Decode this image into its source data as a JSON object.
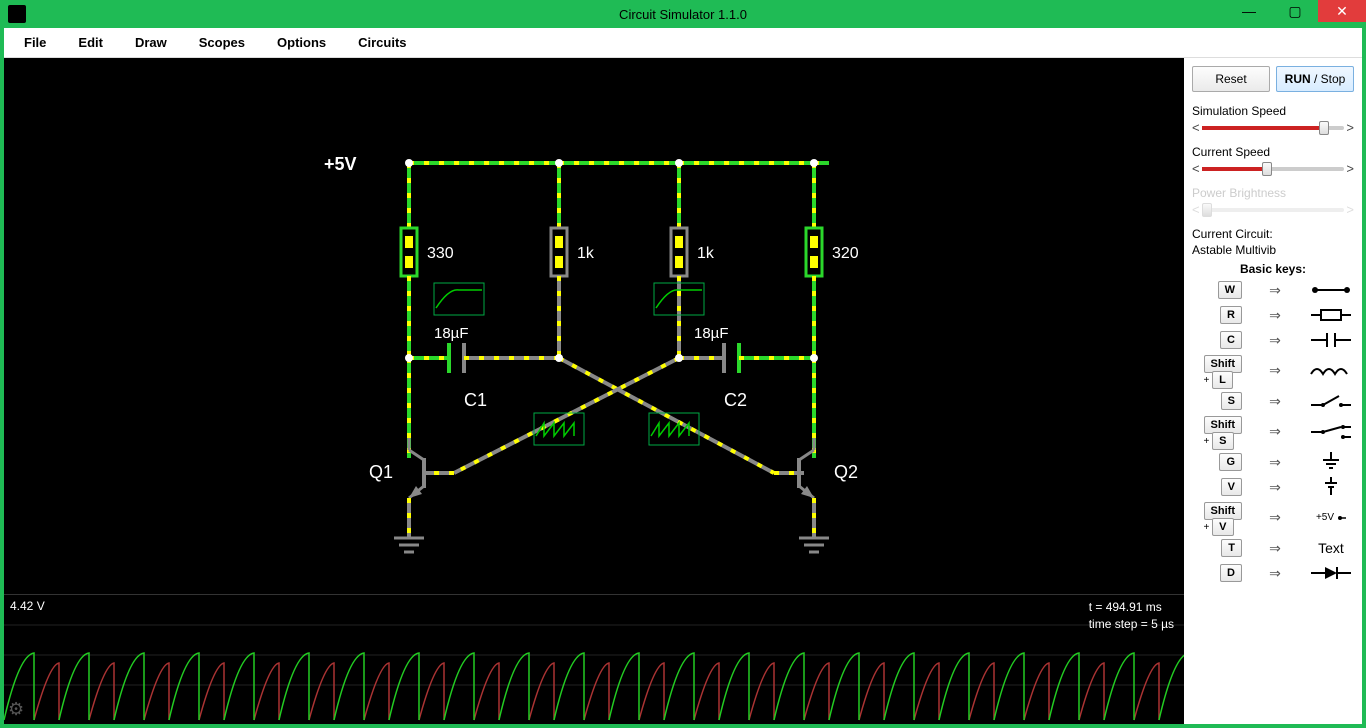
{
  "window": {
    "title": "Circuit Simulator 1.1.0"
  },
  "menubar": {
    "items": [
      "File",
      "Edit",
      "Draw",
      "Scopes",
      "Options",
      "Circuits"
    ]
  },
  "sidebar": {
    "reset_label": "Reset",
    "run_label": "RUN",
    "stop_label": " / Stop",
    "sliders": [
      {
        "label": "Simulation Speed",
        "pos": 82
      },
      {
        "label": "Current Speed",
        "pos": 42
      },
      {
        "label": "Power Brightness",
        "pos": 0,
        "disabled": true
      }
    ],
    "current_circuit_label": "Current Circuit:",
    "current_circuit_value": "Astable Multivib",
    "basic_keys_title": "Basic keys:",
    "keys": [
      {
        "badges": [
          "W"
        ],
        "symbol": "wire"
      },
      {
        "badges": [
          "R"
        ],
        "symbol": "resistor"
      },
      {
        "badges": [
          "C"
        ],
        "symbol": "capacitor"
      },
      {
        "badges": [
          "Shift",
          "L"
        ],
        "symbol": "inductor",
        "shift": true
      },
      {
        "badges": [
          "S"
        ],
        "symbol": "switch-open"
      },
      {
        "badges": [
          "Shift",
          "S"
        ],
        "symbol": "switch-closed",
        "shift": true
      },
      {
        "badges": [
          "G"
        ],
        "symbol": "ground"
      },
      {
        "badges": [
          "V"
        ],
        "symbol": "voltage"
      },
      {
        "badges": [
          "Shift",
          "V"
        ],
        "symbol": "dc-source",
        "text": "+5V",
        "shift": true
      },
      {
        "badges": [
          "T"
        ],
        "symbol": "text",
        "text": "Text"
      },
      {
        "badges": [
          "D"
        ],
        "symbol": "diode"
      }
    ]
  },
  "scope": {
    "voltage": "4.42 V",
    "time": "t = 494.91 ms",
    "timestep": "time step = 5 µs"
  },
  "circuit": {
    "supply_label": "+5V",
    "r1": "330",
    "r2": "1k",
    "r3": "1k",
    "r4": "320",
    "c1_val": "18µF",
    "c1_label": "C1",
    "c2_val": "18µF",
    "c2_label": "C2",
    "q1": "Q1",
    "q2": "Q2"
  }
}
